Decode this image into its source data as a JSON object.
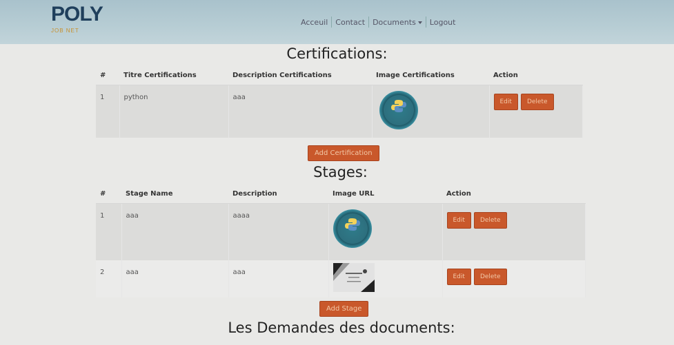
{
  "nav": {
    "brand": "POLY",
    "brand_sub": "JOB NET",
    "links": [
      "Acceuil",
      "Contact",
      "Documents",
      "Logout"
    ]
  },
  "certifications": {
    "heading": "Certifications:",
    "columns": [
      "#",
      "Titre Certifications",
      "Description Certifications",
      "Image Certifications",
      "Action"
    ],
    "rows": [
      {
        "num": "1",
        "title": "python",
        "description": "aaa",
        "image": "python-badge-icon"
      }
    ],
    "edit_label": "Edit",
    "delete_label": "Delete",
    "add_label": "Add Certification"
  },
  "stages": {
    "heading": "Stages:",
    "columns": [
      "#",
      "Stage Name",
      "Description",
      "Image URL",
      "Action"
    ],
    "rows": [
      {
        "num": "1",
        "name": "aaa",
        "description": "aaaa",
        "image": "python-badge-icon"
      },
      {
        "num": "2",
        "name": "aaa",
        "description": "aaa",
        "image": "certificate-thumbnail"
      }
    ],
    "edit_label": "Edit",
    "delete_label": "Delete",
    "add_label": "Add Stage"
  },
  "demandes": {
    "heading": "Les Demandes des documents:"
  },
  "colors": {
    "navbar": "#b7cdd4",
    "button": "#c9582b",
    "brand": "#1f3f5c"
  }
}
